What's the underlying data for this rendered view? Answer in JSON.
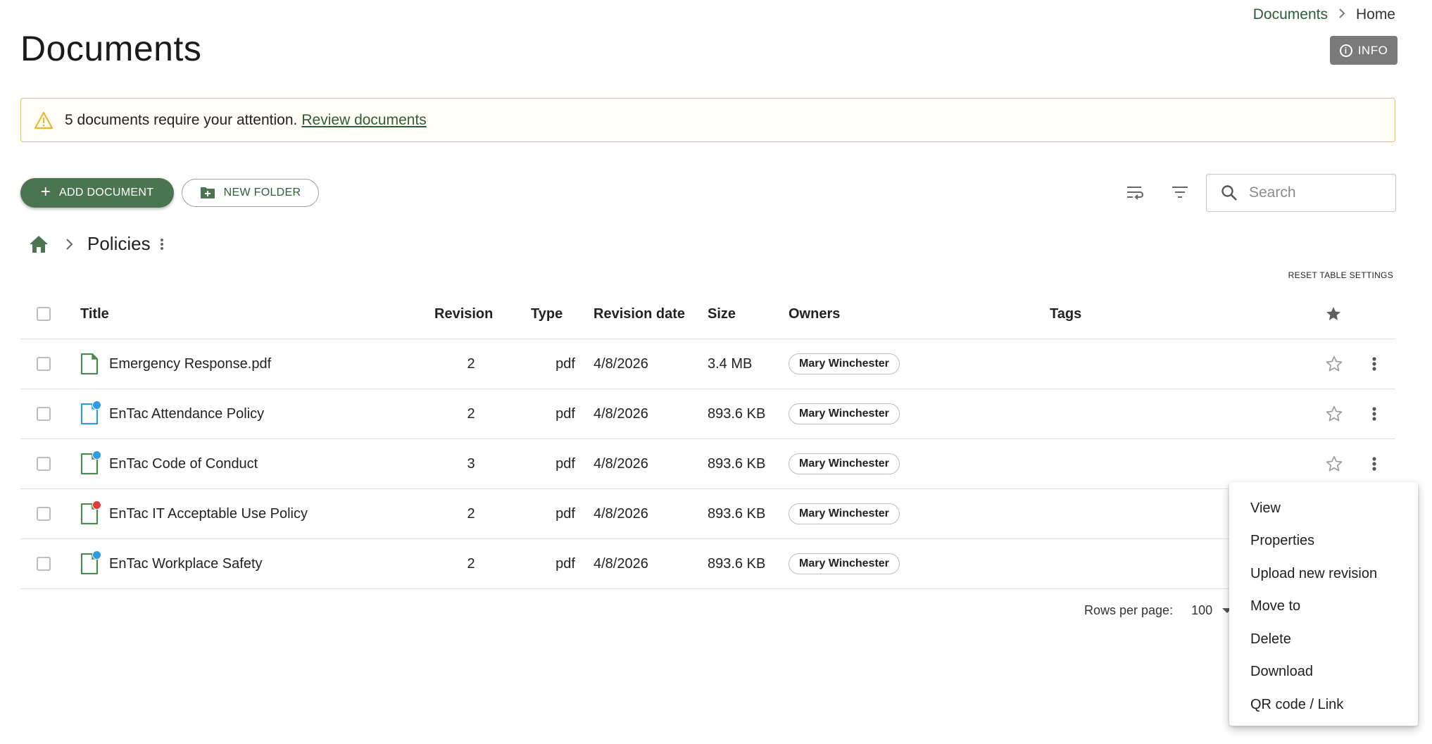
{
  "breadcrumb": {
    "documents": "Documents",
    "separator": "›",
    "home": "Home"
  },
  "page_title": "Documents",
  "info_button": "INFO",
  "alert": {
    "message": "5 documents require your attention.",
    "link": "Review documents"
  },
  "toolbar": {
    "add_document": "ADD DOCUMENT",
    "new_folder": "NEW FOLDER",
    "search_placeholder": "Search"
  },
  "folder": {
    "name": "Policies"
  },
  "reset_table_settings": "RESET TABLE SETTINGS",
  "columns": {
    "title": "Title",
    "revision": "Revision",
    "type": "Type",
    "revision_date": "Revision date",
    "size": "Size",
    "owners": "Owners",
    "tags": "Tags"
  },
  "rows": [
    {
      "title": "Emergency Response.pdf",
      "revision": "2",
      "type": "pdf",
      "date": "4/8/2026",
      "size": "3.4 MB",
      "owner": "Mary Winchester",
      "icon_color": "#4b8a4f",
      "dot_color": ""
    },
    {
      "title": "EnTac Attendance Policy",
      "revision": "2",
      "type": "pdf",
      "date": "4/8/2026",
      "size": "893.6 KB",
      "owner": "Mary Winchester",
      "icon_color": "#2f9be3",
      "dot_color": "#2f9be3"
    },
    {
      "title": "EnTac Code of Conduct",
      "revision": "3",
      "type": "pdf",
      "date": "4/8/2026",
      "size": "893.6 KB",
      "owner": "Mary Winchester",
      "icon_color": "#4b8a4f",
      "dot_color": "#2f9be3"
    },
    {
      "title": "EnTac IT Acceptable Use Policy",
      "revision": "2",
      "type": "pdf",
      "date": "4/8/2026",
      "size": "893.6 KB",
      "owner": "Mary Winchester",
      "icon_color": "#4b8a4f",
      "dot_color": "#e53935"
    },
    {
      "title": "EnTac Workplace Safety",
      "revision": "2",
      "type": "pdf",
      "date": "4/8/2026",
      "size": "893.6 KB",
      "owner": "Mary Winchester",
      "icon_color": "#4b8a4f",
      "dot_color": "#2f9be3"
    }
  ],
  "pagination": {
    "rows_per_page_label": "Rows per page:",
    "rows_per_page_value": "100"
  },
  "context_menu": [
    "View",
    "Properties",
    "Upload new revision",
    "Move to",
    "Delete",
    "Download",
    "QR code / Link"
  ],
  "colors": {
    "brand_green": "#4b7551",
    "link_green": "#2e5d34",
    "alert_border": "#e9c542"
  }
}
